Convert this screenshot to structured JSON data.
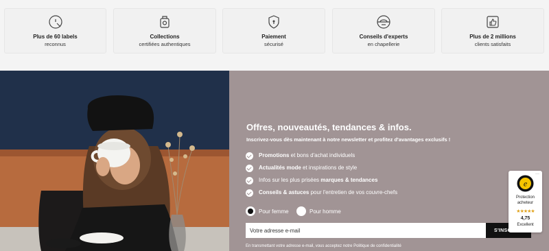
{
  "features": [
    {
      "icon": "label-seal-icon",
      "title": "Plus de 60 labels",
      "subtitle": "reconnus"
    },
    {
      "icon": "collection-badge-icon",
      "title": "Collections",
      "subtitle": "certifiées authentiques"
    },
    {
      "icon": "shield-lock-icon",
      "title": "Paiement",
      "subtitle": "sécurisé"
    },
    {
      "icon": "hat-expert-icon",
      "title": "Conseils d'experts",
      "subtitle": "en chapellerie"
    },
    {
      "icon": "thumbs-up-icon",
      "title": "Plus de 2 millions",
      "subtitle": "clients satisfaits"
    }
  ],
  "newsletter": {
    "title": "Offres, nouveautés, tendances & infos.",
    "subtitle": "Inscrivez-vous dès maintenant à notre newsletter et profitez d'avantages exclusifs !",
    "benefits": [
      {
        "bold": "Promotions",
        "text": " et bons d'achat individuels",
        "bold2": "",
        "tail": ""
      },
      {
        "bold": "Actualités mode",
        "text": " et inspirations de style",
        "bold2": "",
        "tail": ""
      },
      {
        "bold": "",
        "text": "Infos sur les plus prisées ",
        "bold2": "marques & tendances",
        "tail": ""
      },
      {
        "bold": "Conseils & astuces",
        "text": " pour l'entretien de vos couvre-chefs",
        "bold2": "",
        "tail": ""
      }
    ],
    "gender_options": [
      {
        "label": "Pour femme",
        "selected": true
      },
      {
        "label": "Pour homme",
        "selected": false
      }
    ],
    "email_placeholder": "Votre adresse e-mail",
    "subscribe_label": "S'INSCRIRE",
    "legal": "En transmettant votre adresse e-mail, vous acceptez notre Politique de confidentialité"
  },
  "trust_badge": {
    "menu": "···",
    "label_line1": "Protection",
    "label_line2": "acheteur",
    "stars": "★★★★★",
    "score": "4,75",
    "rating_word": "Excellent"
  },
  "colors": {
    "panel": "#a19495",
    "button": "#111111",
    "star": "#e0a21b"
  }
}
